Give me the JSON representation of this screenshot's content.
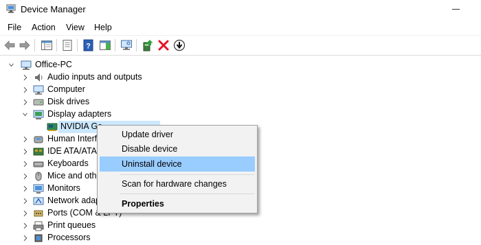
{
  "window": {
    "title": "Device Manager"
  },
  "menu": [
    "File",
    "Action",
    "View",
    "Help"
  ],
  "toolbar": {
    "icons": [
      "back-arrow-icon",
      "forward-arrow-icon",
      "show-hide-tree-icon",
      "properties-icon",
      "help-icon",
      "action-pane-icon",
      "monitor-scan-icon",
      "update-driver-icon",
      "uninstall-x-icon",
      "download-circle-icon"
    ]
  },
  "tree": {
    "root": "Office-PC",
    "items": [
      {
        "label": "Audio inputs and outputs",
        "expanded": false
      },
      {
        "label": "Computer",
        "expanded": false
      },
      {
        "label": "Disk drives",
        "expanded": false
      },
      {
        "label": "Display adapters",
        "expanded": true
      },
      {
        "label": "NVIDIA Ge",
        "child": true,
        "selected": true
      },
      {
        "label": "Human Interf",
        "expanded": false
      },
      {
        "label": "IDE ATA/ATAP",
        "expanded": false
      },
      {
        "label": "Keyboards",
        "expanded": false
      },
      {
        "label": "Mice and othe",
        "expanded": false
      },
      {
        "label": "Monitors",
        "expanded": false
      },
      {
        "label": "Network adap",
        "expanded": false
      },
      {
        "label": "Ports (COM & LPT)",
        "expanded": false
      },
      {
        "label": "Print queues",
        "expanded": false
      },
      {
        "label": "Processors",
        "expanded": false
      }
    ]
  },
  "context_menu": {
    "items": [
      {
        "label": "Update driver"
      },
      {
        "label": "Disable device"
      },
      {
        "label": "Uninstall device",
        "highlighted": true
      },
      {
        "label": "Scan for hardware changes"
      },
      {
        "label": "Properties",
        "bold": true
      }
    ]
  },
  "colors": {
    "selection": "#cce8ff",
    "menu_highlight": "#99ccff",
    "uninstall_red": "#e81123"
  }
}
